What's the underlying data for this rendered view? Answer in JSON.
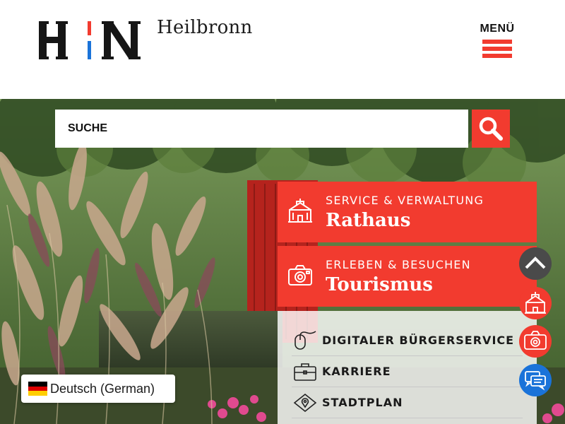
{
  "header": {
    "logo_alt": "HN",
    "city_name": "Heilbronn",
    "menu_label": "MENÜ"
  },
  "search": {
    "placeholder": "SUCHE",
    "button_icon": "search-icon"
  },
  "tiles": [
    {
      "kicker": "SERVICE & VERWALTUNG",
      "title": "Rathaus",
      "icon": "town-hall-icon"
    },
    {
      "kicker": "ERLEBEN & BESUCHEN",
      "title": "Tourismus",
      "icon": "camera-icon"
    }
  ],
  "quick_links": [
    {
      "label": "DIGITALER BÜRGERSERVICE",
      "icon": "mouse-icon"
    },
    {
      "label": "KARRIERE",
      "icon": "briefcase-icon"
    },
    {
      "label": "STADTPLAN",
      "icon": "map-icon"
    }
  ],
  "floating_buttons": [
    {
      "name": "scroll-top",
      "icon": "chevron-up-icon"
    },
    {
      "name": "rathaus-shortcut",
      "icon": "town-hall-icon"
    },
    {
      "name": "tourismus-shortcut",
      "icon": "camera-icon"
    },
    {
      "name": "chat",
      "icon": "chat-icon"
    }
  ],
  "language": {
    "label": "Deutsch (German)",
    "flag_icon": "german-flag-icon"
  },
  "colors": {
    "accent_red": "#f23b2f",
    "logo_blue": "#1a73d9",
    "chat_blue": "#1a73d9",
    "scroll_gray": "#4a4a4a"
  }
}
